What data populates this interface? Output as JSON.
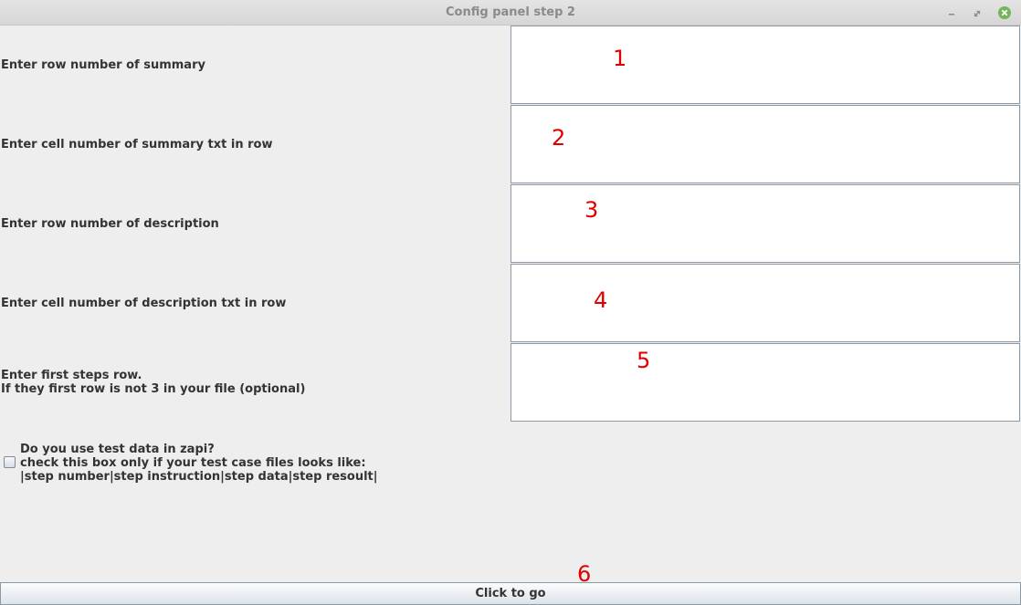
{
  "window": {
    "title": "Config panel step 2",
    "controls": {
      "minimize_icon": "minimize-icon",
      "maximize_icon": "maximize-icon",
      "close_icon": "close-icon",
      "close_color": "#73b45c"
    }
  },
  "form": {
    "fields": [
      {
        "label": "Enter row number of summary",
        "value": "",
        "annotation": "1"
      },
      {
        "label": "Enter cell number of summary txt in row",
        "value": "",
        "annotation": "2"
      },
      {
        "label": "Enter row number of description",
        "value": "",
        "annotation": "3"
      },
      {
        "label": "Enter cell number of description txt in row",
        "value": "",
        "annotation": "4"
      },
      {
        "label": "Enter first steps row.",
        "label_line2": "If they first row is not 3 in your file (optional)",
        "value": "",
        "annotation": "5"
      }
    ],
    "test_data": {
      "checked": false,
      "line1": "Do you use test data in zapi?",
      "line2": "check this box only if your test case files looks like:",
      "line3": "|step number|step instruction|step data|step resoult|"
    },
    "go_button": {
      "label": "Click to go",
      "annotation": "6"
    }
  },
  "colors": {
    "background": "#eeeeee",
    "annotation": "#e00000",
    "field_border": "#8d9aa6"
  }
}
